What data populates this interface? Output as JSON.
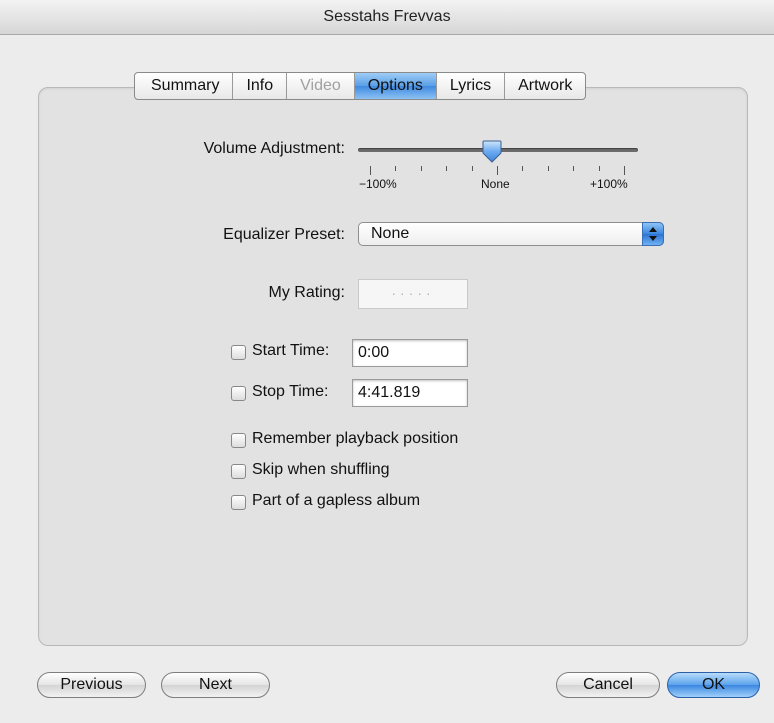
{
  "window": {
    "title": "Sesstahs Frevvas"
  },
  "tabs": [
    {
      "label": "Summary",
      "state": "normal"
    },
    {
      "label": "Info",
      "state": "normal"
    },
    {
      "label": "Video",
      "state": "disabled"
    },
    {
      "label": "Options",
      "state": "active"
    },
    {
      "label": "Lyrics",
      "state": "normal"
    },
    {
      "label": "Artwork",
      "state": "normal"
    }
  ],
  "volume": {
    "label": "Volume Adjustment:",
    "min_label": "−100%",
    "mid_label": "None",
    "max_label": "+100%",
    "value_percent": 0
  },
  "equalizer": {
    "label": "Equalizer Preset:",
    "value": "None"
  },
  "rating": {
    "label": "My Rating:",
    "stars": 0,
    "dots": "·····"
  },
  "start_time": {
    "label": "Start Time:",
    "value": "0:00",
    "checked": false
  },
  "stop_time": {
    "label": "Stop Time:",
    "value": "4:41.819",
    "checked": false
  },
  "options": {
    "remember_playback": {
      "label": "Remember playback position",
      "checked": false
    },
    "skip_shuffling": {
      "label": "Skip when shuffling",
      "checked": false
    },
    "gapless": {
      "label": "Part of a gapless album",
      "checked": false
    }
  },
  "buttons": {
    "previous": "Previous",
    "next": "Next",
    "cancel": "Cancel",
    "ok": "OK"
  },
  "colors": {
    "accent": "#3b87e1",
    "window_bg": "#ececec",
    "panel_bg": "#e2e2e2"
  }
}
